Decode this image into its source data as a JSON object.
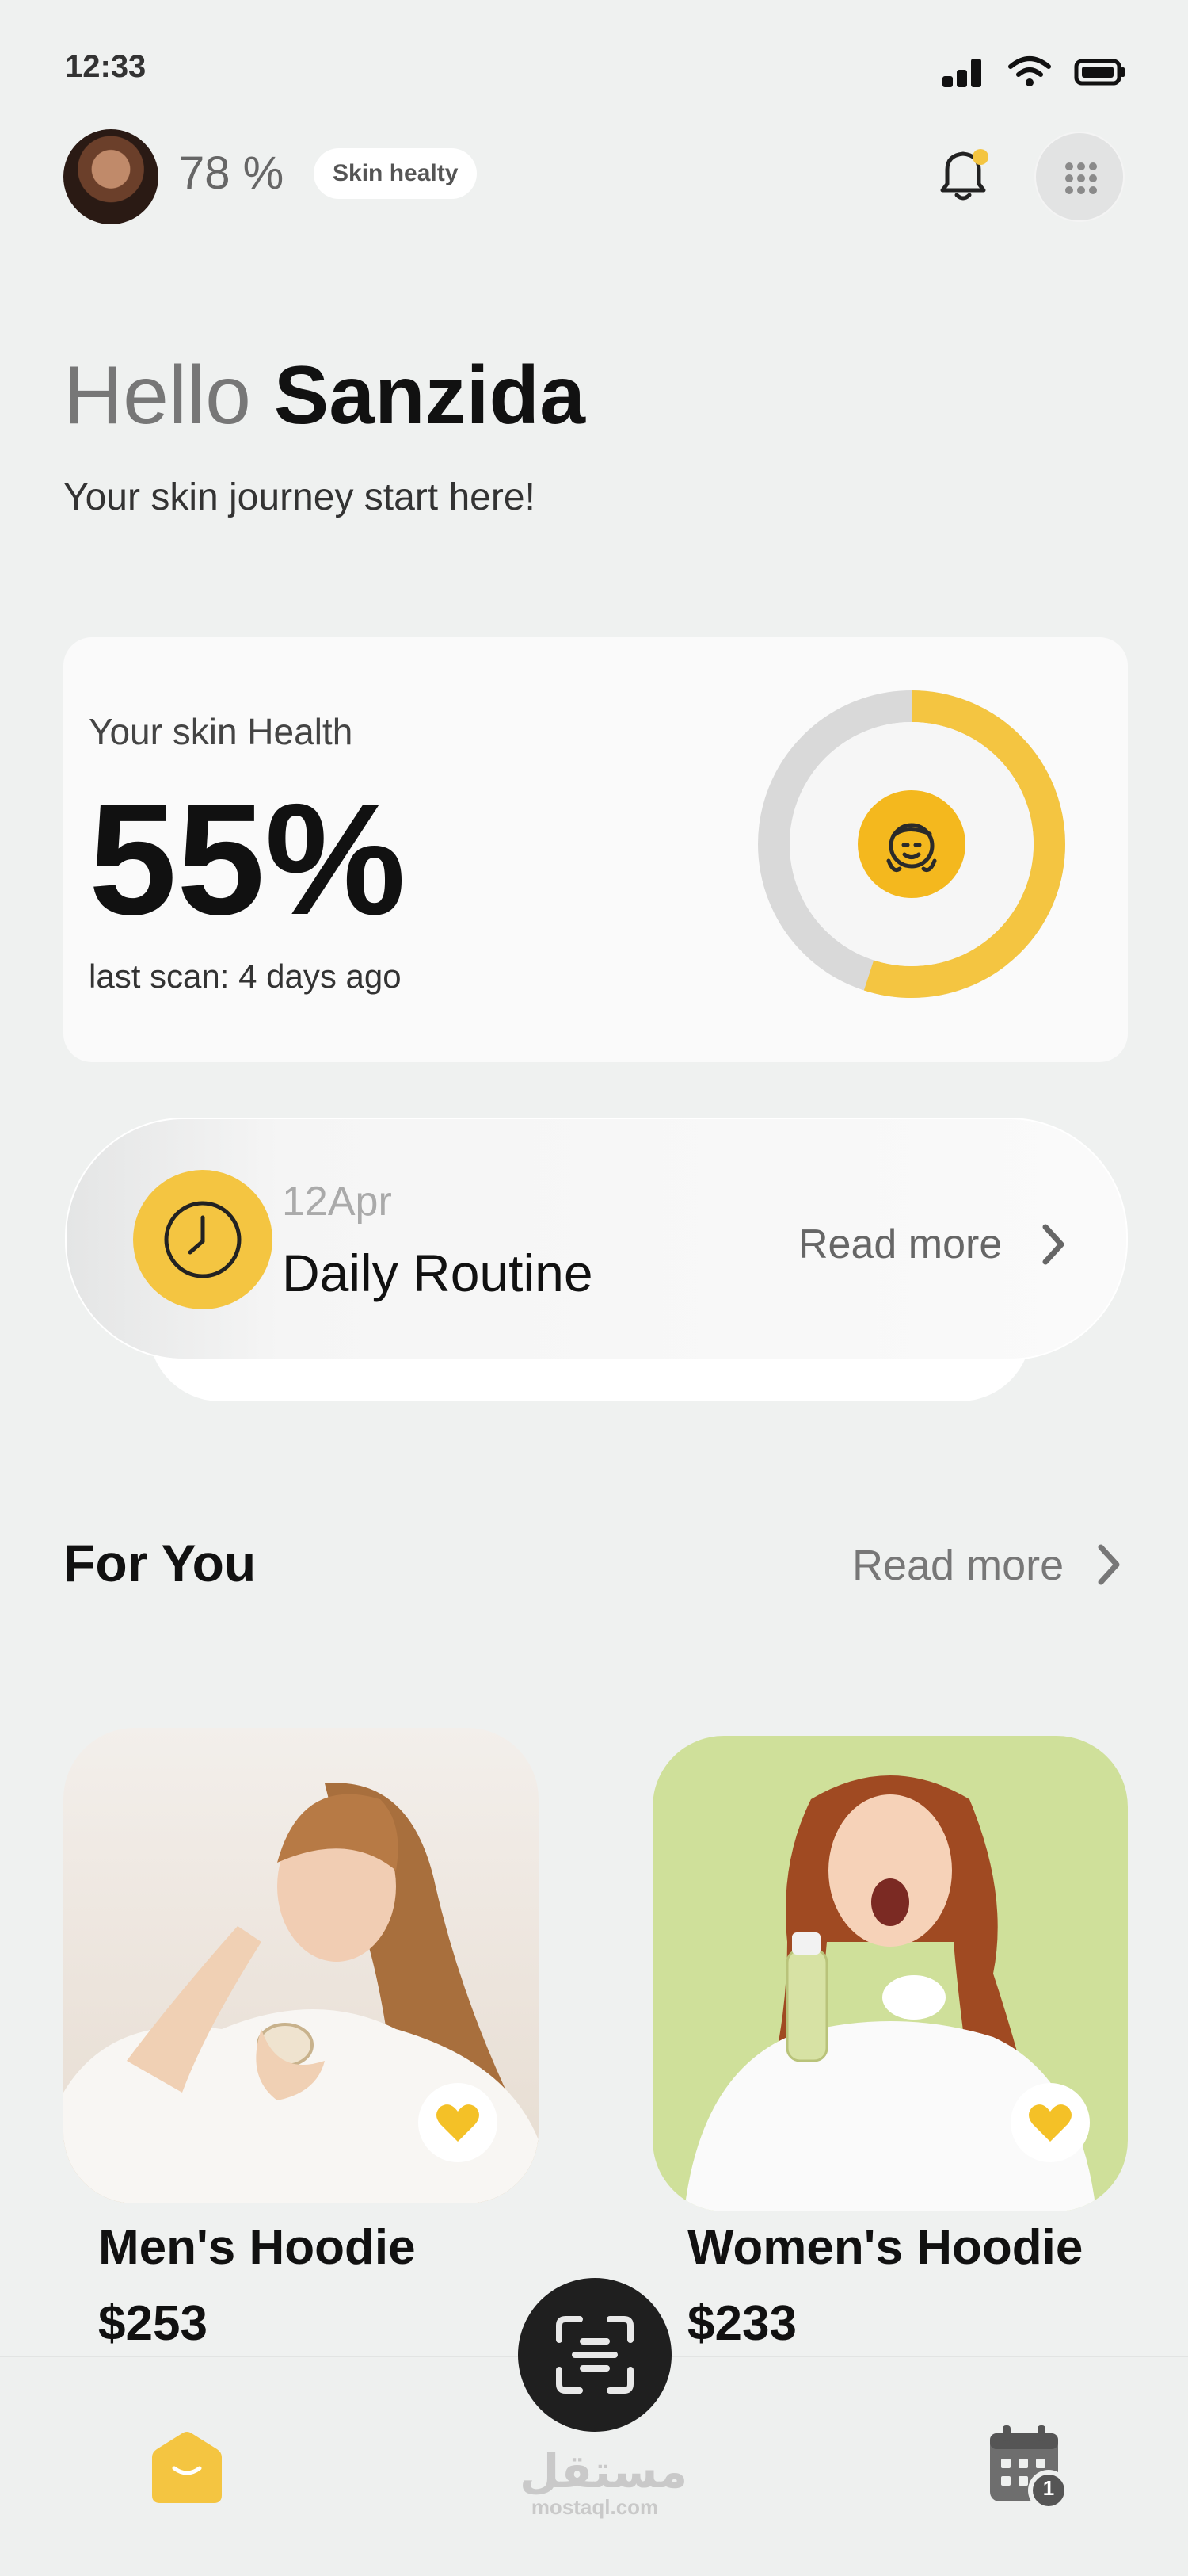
{
  "status_bar": {
    "time": "12:33"
  },
  "header": {
    "skin_percent": "78 %",
    "skin_badge": "Skin healty"
  },
  "greeting": {
    "hello": "Hello",
    "name": "Sanzida",
    "subtitle": "Your skin journey start here!"
  },
  "health_card": {
    "label": "Your skin Health",
    "value": "55%",
    "progress": 0.55,
    "last_scan": "last scan: 4 days ago"
  },
  "routine": {
    "date": "12Apr",
    "title": "Daily Routine",
    "read_more": "Read more"
  },
  "for_you": {
    "title": "For You",
    "read_more": "Read more",
    "products": [
      {
        "name": "Men's Hoodie",
        "price": "$253"
      },
      {
        "name": "Women's Hoodie",
        "price": "$233"
      }
    ]
  },
  "bottom_nav": {
    "calendar_badge": "1"
  },
  "watermark": {
    "arabic": "مستقل",
    "latin": "mostaql.com"
  },
  "colors": {
    "accent": "#f4c541",
    "background": "#eff1f0",
    "dark": "#1f1f1f"
  }
}
